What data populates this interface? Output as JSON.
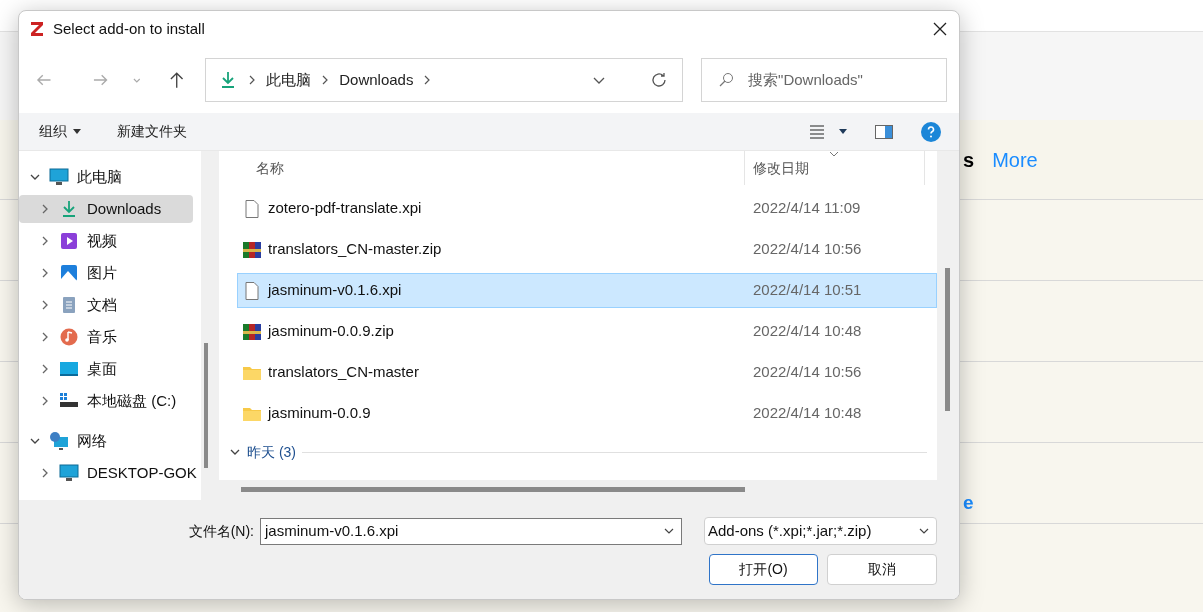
{
  "background_page": {
    "nav_text": "s",
    "nav_link": "More",
    "footer_link": "e"
  },
  "dialog": {
    "title": "Select add-on to install",
    "breadcrumb": [
      "此电脑",
      "Downloads"
    ],
    "search": {
      "placeholder": "搜索\"Downloads\""
    },
    "toolbar": {
      "organize": "组织",
      "new_folder": "新建文件夹"
    },
    "sidebar": {
      "items": [
        {
          "label": "此电脑",
          "kind": "pc",
          "expanded": true,
          "selected": false,
          "children": [
            {
              "label": "Downloads",
              "kind": "download",
              "expanded": false,
              "selected": true
            },
            {
              "label": "视频",
              "kind": "video",
              "expanded": false,
              "selected": false
            },
            {
              "label": "图片",
              "kind": "pictures",
              "expanded": false,
              "selected": false
            },
            {
              "label": "文档",
              "kind": "documents",
              "expanded": false,
              "selected": false
            },
            {
              "label": "音乐",
              "kind": "music",
              "expanded": false,
              "selected": false
            },
            {
              "label": "桌面",
              "kind": "desktop",
              "expanded": false,
              "selected": false
            },
            {
              "label": "本地磁盘 (C:)",
              "kind": "drive",
              "expanded": false,
              "selected": false
            }
          ]
        },
        {
          "label": "网络",
          "kind": "network",
          "expanded": true,
          "selected": false,
          "children": [
            {
              "label": "DESKTOP-GOK",
              "kind": "pc",
              "expanded": false,
              "selected": false
            }
          ]
        }
      ]
    },
    "columns": [
      "名称",
      "修改日期"
    ],
    "files": [
      {
        "name": "zotero-pdf-translate.xpi",
        "date": "2022/4/14 11:09",
        "kind": "file",
        "selected": false
      },
      {
        "name": "translators_CN-master.zip",
        "date": "2022/4/14 10:56",
        "kind": "archive",
        "selected": false
      },
      {
        "name": "jasminum-v0.1.6.xpi",
        "date": "2022/4/14 10:51",
        "kind": "file",
        "selected": true
      },
      {
        "name": "jasminum-0.0.9.zip",
        "date": "2022/4/14 10:48",
        "kind": "archive",
        "selected": false
      },
      {
        "name": "translators_CN-master",
        "date": "2022/4/14 10:56",
        "kind": "folder",
        "selected": false
      },
      {
        "name": "jasminum-0.0.9",
        "date": "2022/4/14 10:48",
        "kind": "folder",
        "selected": false
      }
    ],
    "group_header": {
      "label": "昨天 (3)",
      "expanded": true
    },
    "footer": {
      "filename_label": "文件名(N):",
      "filename": "jasminum-v0.1.6.xpi",
      "filter": "Add-ons (*.xpi;*.jar;*.zip)",
      "open_button": "打开(O)",
      "cancel_button": "取消"
    }
  }
}
